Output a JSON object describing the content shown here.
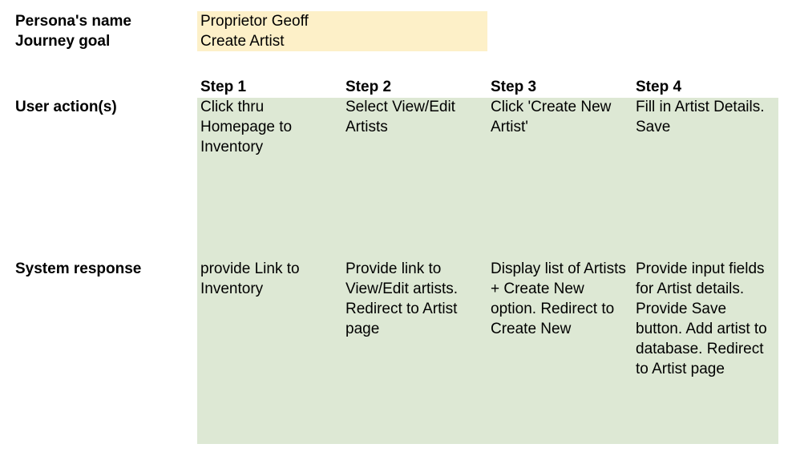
{
  "persona": {
    "name_label": "Persona's name",
    "name_value": "Proprietor Geoff",
    "goal_label": "Journey goal",
    "goal_value": "Create Artist"
  },
  "colors": {
    "persona_fill": "#fdf0c8",
    "table_fill": "#dde8d4"
  },
  "rows": {
    "user_action_label": "User action(s)",
    "system_response_label": "System response"
  },
  "steps": [
    {
      "header": "Step 1",
      "user_action": "Click thru Homepage to Inventory",
      "system_response": "provide Link to Inventory"
    },
    {
      "header": "Step 2",
      "user_action": "Select View/Edit Artists",
      "system_response": "Provide link to View/Edit artists. Redirect to Artist page"
    },
    {
      "header": "Step 3",
      "user_action": "Click 'Create New Artist'",
      "system_response": "Display list of Artists + Create New option. Redirect to Create New"
    },
    {
      "header": "Step 4",
      "user_action": "Fill in Artist Details. Save",
      "system_response": "Provide input fields for Artist details. Provide Save button. Add artist to database. Redirect to Artist page"
    }
  ]
}
